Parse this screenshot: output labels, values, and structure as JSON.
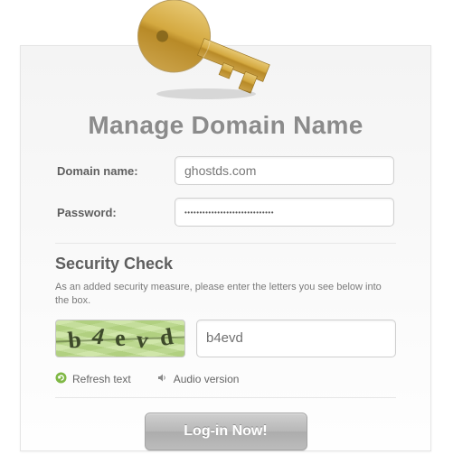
{
  "title": "Manage Domain Name",
  "form": {
    "domain_label": "Domain name:",
    "domain_value": "ghostds.com",
    "password_label": "Password:",
    "password_value": "••••••••••••••••••••••••••••••"
  },
  "security": {
    "title": "Security Check",
    "description": "As an added security measure, please enter the letters you see below into the box.",
    "captcha_chars": [
      "b",
      "4",
      "e",
      "v",
      "d"
    ],
    "captcha_input_value": "b4evd",
    "refresh_label": "Refresh text",
    "audio_label": "Audio version"
  },
  "login_button_label": "Log-in Now!"
}
